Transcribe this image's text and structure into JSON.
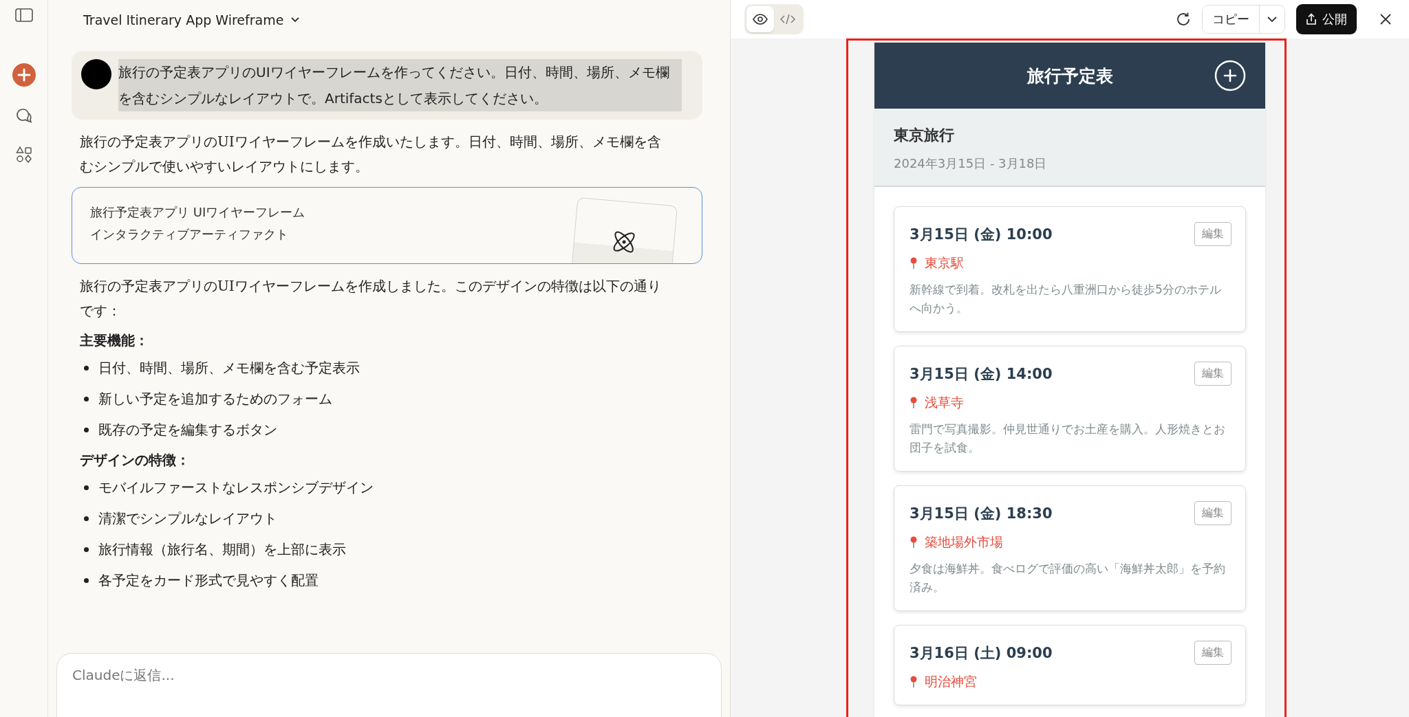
{
  "conversation": {
    "title": "Travel Itinerary App Wireframe",
    "user_message": "旅行の予定表アプリのUIワイヤーフレームを作ってください。日付、時間、場所、メモ欄を含むシンプルなレイアウトで。Artifactsとして表示してください。",
    "intro": "旅行の予定表アプリのUIワイヤーフレームを作成いたします。日付、時間、場所、メモ欄を含むシンプルで使いやすいレイアウトにします。",
    "artifact": {
      "title": "旅行予定表アプリ UIワイヤーフレーム",
      "subtitle": "インタラクティブアーティファクト"
    },
    "summary": "旅行の予定表アプリのUIワイヤーフレームを作成しました。このデザインの特徴は以下の通りです：",
    "sections": [
      {
        "heading": "主要機能：",
        "items": [
          "日付、時間、場所、メモ欄を含む予定表示",
          "新しい予定を追加するためのフォーム",
          "既存の予定を編集するボタン"
        ]
      },
      {
        "heading": "デザインの特徴：",
        "items": [
          "モバイルファーストなレスポンシブデザイン",
          "清潔でシンプルなレイアウト",
          "旅行情報（旅行名、期間）を上部に表示",
          "各予定をカード形式で見やすく配置"
        ]
      }
    ],
    "reply_field": {
      "placeholder": "Claudeに返信..."
    }
  },
  "preview_toolbar": {
    "view_toggle": [
      {
        "kind": "preview",
        "selected": true
      },
      {
        "kind": "code",
        "selected": false
      }
    ],
    "copy_button": "コピー",
    "publish_button": "公開"
  },
  "app": {
    "title": "旅行予定表",
    "trip": {
      "name": "東京旅行",
      "period": "2024年3月15日 - 3月18日"
    },
    "events": [
      {
        "datetime": "3月15日 (金) 10:00",
        "location": "東京駅",
        "memo": "新幹線で到着。改札を出たら八重洲口から徒歩5分のホテルへ向かう。",
        "edit_button": "編集"
      },
      {
        "datetime": "3月15日 (金) 14:00",
        "location": "浅草寺",
        "memo": "雷門で写真撮影。仲見世通りでお土産を購入。人形焼きとお団子を試食。",
        "edit_button": "編集"
      },
      {
        "datetime": "3月15日 (金) 18:30",
        "location": "築地場外市場",
        "memo": "夕食は海鮮丼。食べログで評価の高い「海鮮丼太郎」を予約済み。",
        "edit_button": "編集"
      },
      {
        "datetime": "3月16日 (土) 09:00",
        "location": "明治神宮",
        "edit_button": "編集"
      }
    ]
  }
}
